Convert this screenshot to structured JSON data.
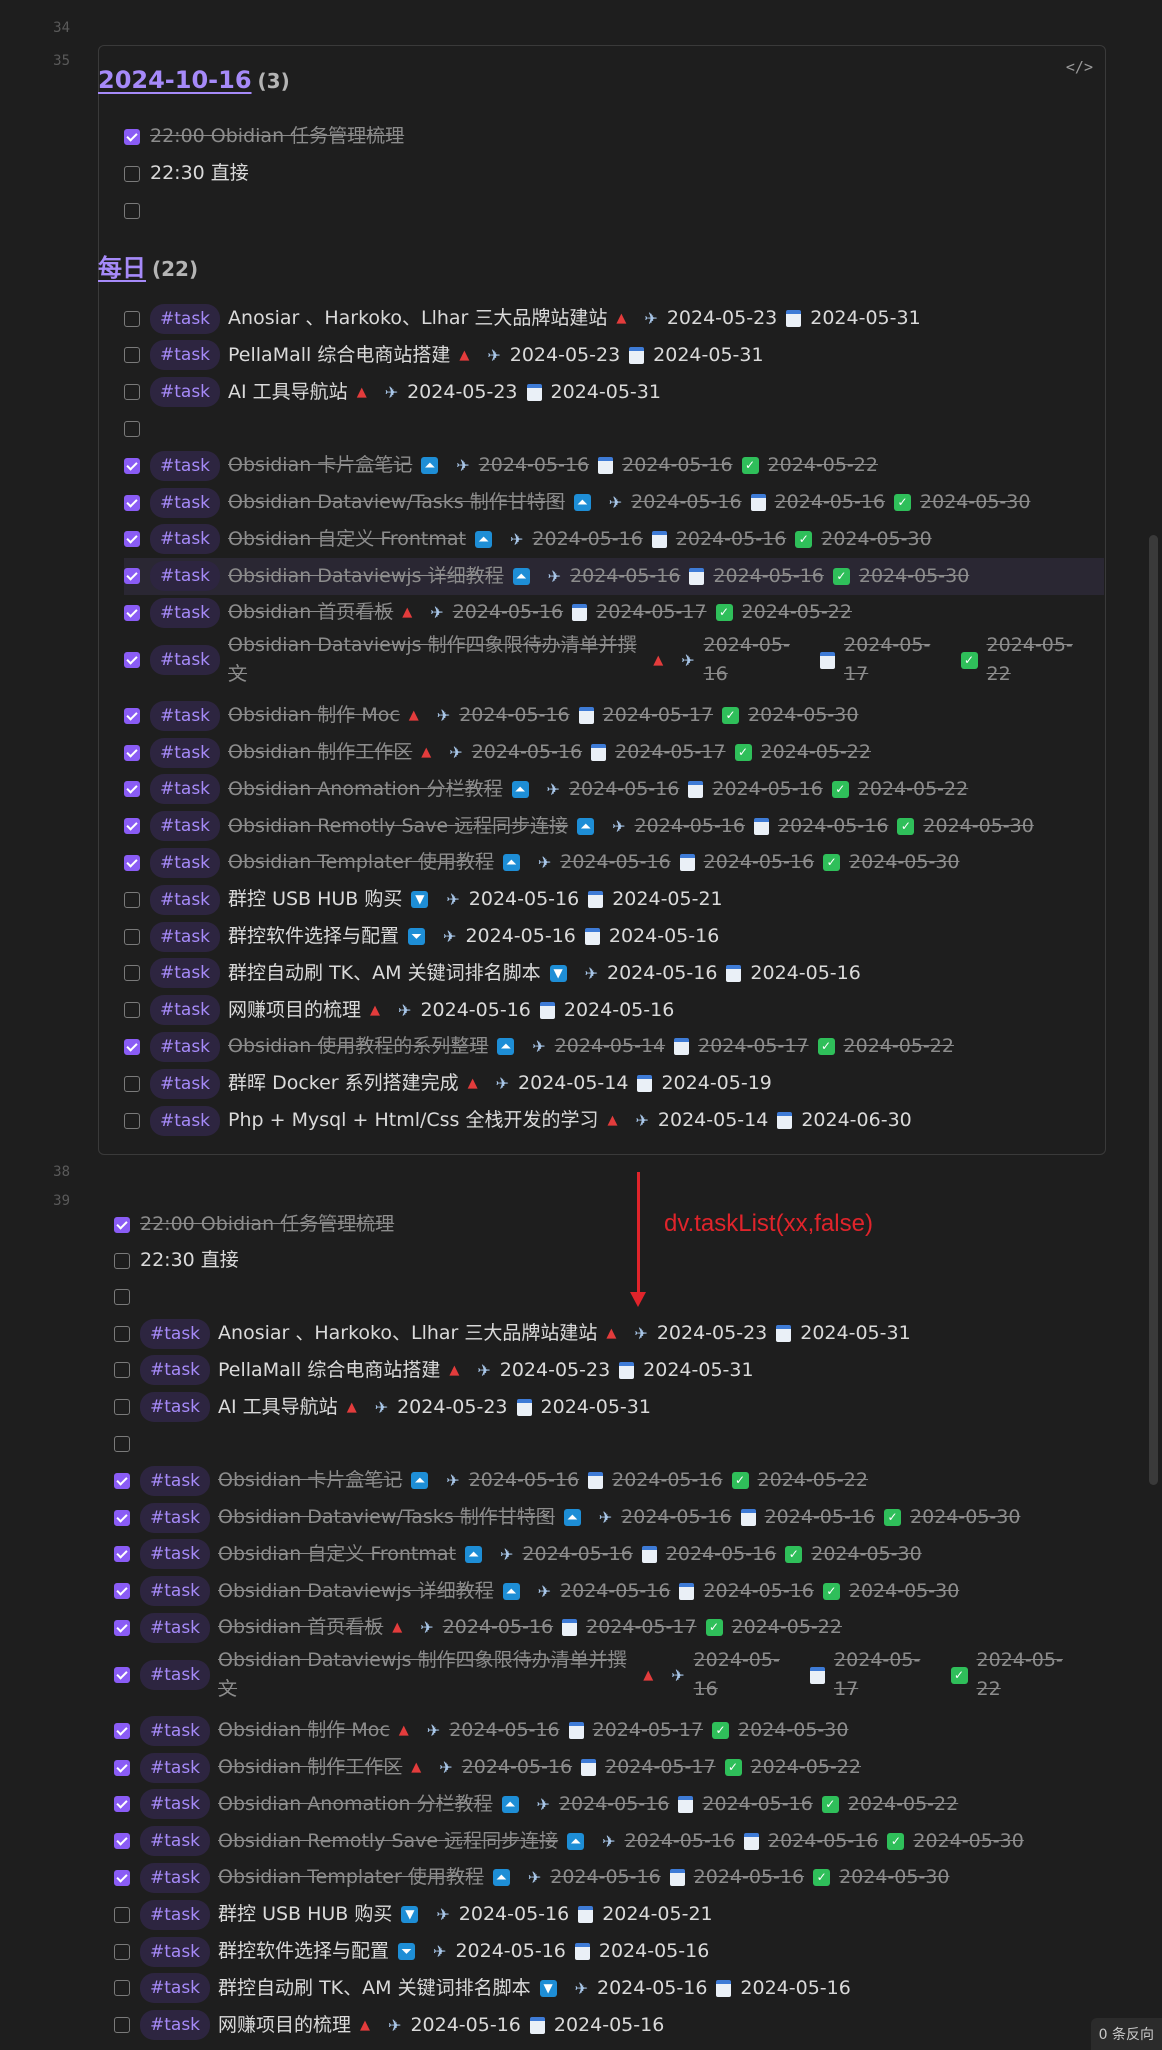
{
  "line_numbers": {
    "l34": "34",
    "l35": "35",
    "l38": "38",
    "l39": "39"
  },
  "card": {
    "code_icon": "</>",
    "group1": {
      "title": "2024-10-16",
      "count": "(3)"
    },
    "group2": {
      "title": "每日",
      "count": "(22)"
    }
  },
  "annotation": "dv.taskList(xx,false)",
  "status_bar": "0 条反向",
  "tasks_top": [
    {
      "done": true,
      "tag": "",
      "text": "22:00 Obidian 任务管理梳理",
      "meta": []
    },
    {
      "done": false,
      "tag": "",
      "text": "22:30 直接",
      "meta": []
    },
    {
      "done": false,
      "tag": "",
      "text": "",
      "meta": []
    }
  ],
  "tasks_daily": [
    {
      "done": false,
      "tag": "#task",
      "text": "Anosiar 、Harkoko、Llhar 三大品牌站建站",
      "p": "high",
      "start": "2024-05-23",
      "due": "2024-05-31",
      "completed": ""
    },
    {
      "done": false,
      "tag": "#task",
      "text": "PellaMall 综合电商站搭建",
      "p": "high",
      "start": "2024-05-23",
      "due": "2024-05-31",
      "completed": ""
    },
    {
      "done": false,
      "tag": "#task",
      "text": "AI 工具导航站",
      "p": "high",
      "start": "2024-05-23",
      "due": "2024-05-31",
      "completed": ""
    },
    {
      "done": false,
      "tag": "",
      "text": "",
      "p": "",
      "start": "",
      "due": "",
      "completed": ""
    },
    {
      "done": true,
      "tag": "#task",
      "text": "Obsidian 卡片盒笔记",
      "p": "highest",
      "start": "2024-05-16",
      "due": "2024-05-16",
      "completed": "2024-05-22"
    },
    {
      "done": true,
      "tag": "#task",
      "text": "Obsidian Dataview/Tasks 制作甘特图",
      "p": "highest",
      "start": "2024-05-16",
      "due": "2024-05-16",
      "completed": "2024-05-30"
    },
    {
      "done": true,
      "tag": "#task",
      "text": "Obsidian 自定义 Frontmat",
      "p": "highest",
      "start": "2024-05-16",
      "due": "2024-05-16",
      "completed": "2024-05-30"
    },
    {
      "done": true,
      "tag": "#task",
      "text": "Obsidian Dataviewjs 详细教程",
      "p": "highest",
      "start": "2024-05-16",
      "due": "2024-05-16",
      "completed": "2024-05-30"
    },
    {
      "done": true,
      "tag": "#task",
      "text": "Obsidian 首页看板",
      "p": "high",
      "start": "2024-05-16",
      "due": "2024-05-17",
      "completed": "2024-05-22"
    },
    {
      "done": true,
      "tag": "#task",
      "text": "Obsidian Dataviewjs 制作四象限待办清单并撰文",
      "p": "high",
      "start": "2024-05-16",
      "due": "2024-05-17",
      "completed": "2024-05-22"
    },
    {
      "done": true,
      "tag": "#task",
      "text": "Obsidian 制作 Moc",
      "p": "high",
      "start": "2024-05-16",
      "due": "2024-05-17",
      "completed": "2024-05-30"
    },
    {
      "done": true,
      "tag": "#task",
      "text": "Obsidian 制作工作区",
      "p": "high",
      "start": "2024-05-16",
      "due": "2024-05-17",
      "completed": "2024-05-22"
    },
    {
      "done": true,
      "tag": "#task",
      "text": "Obsidian Anomation 分栏教程",
      "p": "highest",
      "start": "2024-05-16",
      "due": "2024-05-16",
      "completed": "2024-05-22"
    },
    {
      "done": true,
      "tag": "#task",
      "text": "Obsidian Remotly Save 远程同步连接",
      "p": "highest",
      "start": "2024-05-16",
      "due": "2024-05-16",
      "completed": "2024-05-30"
    },
    {
      "done": true,
      "tag": "#task",
      "text": "Obsidian Templater 使用教程",
      "p": "highest",
      "start": "2024-05-16",
      "due": "2024-05-16",
      "completed": "2024-05-30"
    },
    {
      "done": false,
      "tag": "#task",
      "text": "群控 USB HUB 购买",
      "p": "low",
      "start": "2024-05-16",
      "due": "2024-05-21",
      "completed": ""
    },
    {
      "done": false,
      "tag": "#task",
      "text": "群控软件选择与配置",
      "p": "lowest",
      "start": "2024-05-16",
      "due": "2024-05-16",
      "completed": ""
    },
    {
      "done": false,
      "tag": "#task",
      "text": "群控自动刷 TK、AM 关键词排名脚本",
      "p": "low",
      "start": "2024-05-16",
      "due": "2024-05-16",
      "completed": ""
    },
    {
      "done": false,
      "tag": "#task",
      "text": "网赚项目的梳理",
      "p": "high",
      "start": "2024-05-16",
      "due": "2024-05-16",
      "completed": ""
    },
    {
      "done": true,
      "tag": "#task",
      "text": "Obsidian 使用教程的系列整理",
      "p": "highest",
      "start": "2024-05-14",
      "due": "2024-05-17",
      "completed": "2024-05-22"
    },
    {
      "done": false,
      "tag": "#task",
      "text": "群晖 Docker 系列搭建完成",
      "p": "high",
      "start": "2024-05-14",
      "due": "2024-05-19",
      "completed": ""
    },
    {
      "done": false,
      "tag": "#task",
      "text": "Php + Mysql + Html/Css 全栈开发的学习",
      "p": "high",
      "start": "2024-05-14",
      "due": "2024-06-30",
      "completed": ""
    }
  ],
  "icons": {
    "priority_high": "triangle-up-icon",
    "priority_highest": "double-up-icon",
    "priority_low": "down-icon",
    "priority_lowest": "double-down-icon",
    "start": "airplane-icon",
    "due": "calendar-icon",
    "completed": "check-icon"
  },
  "colors": {
    "accent": "#a68af9",
    "checkbox": "#8a5cf5",
    "annotation": "#e0242b",
    "background": "#1e1e1e"
  }
}
